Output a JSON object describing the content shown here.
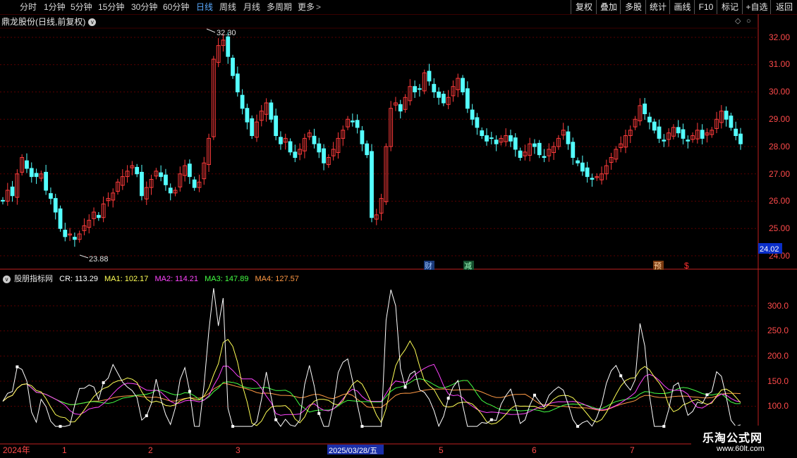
{
  "toolbar": {
    "periods": [
      "分时",
      "1分钟",
      "5分钟",
      "15分钟",
      "30分钟",
      "60分钟",
      "日线",
      "周线",
      "月线",
      "多周期",
      "更多"
    ],
    "active_period": "日线",
    "more_symbol": ">",
    "right_buttons": [
      "复权",
      "叠加",
      "多股",
      "统计",
      "画线",
      "F10",
      "标记",
      "+自选",
      "返回"
    ]
  },
  "stock": {
    "name": "鼎龙股份",
    "mode": "(日线,前复权)",
    "chevron": "v"
  },
  "price_axis": {
    "ticks": [
      "32.00",
      "31.00",
      "30.00",
      "29.00",
      "28.00",
      "27.00",
      "26.00",
      "25.00",
      "24.00"
    ],
    "current": "24.02"
  },
  "annotations": {
    "high": "32.30",
    "low": "23.88"
  },
  "event_markers": [
    {
      "label": "财",
      "color": "#3a7bd5"
    },
    {
      "label": "减",
      "color": "#2e8b57"
    },
    {
      "label": "预",
      "color": "#d2691e"
    },
    {
      "label": "$",
      "color": "#ff3030"
    }
  ],
  "indicator": {
    "name": "股朋指标网",
    "values": [
      {
        "label": "CR: 113.29",
        "color": "#ffffff"
      },
      {
        "label": "MA1: 102.17",
        "color": "#ffff55"
      },
      {
        "label": "MA2: 114.21",
        "color": "#ff44ff"
      },
      {
        "label": "MA3: 147.89",
        "color": "#44ff44"
      },
      {
        "label": "MA4: 127.57",
        "color": "#ff9944"
      }
    ],
    "ticks": [
      "300.0",
      "250.0",
      "200.0",
      "150.0",
      "100.0"
    ]
  },
  "date_axis": {
    "labels": [
      "2024年",
      "1",
      "2",
      "3",
      "2025/03/28/五",
      "5",
      "6",
      "7"
    ]
  },
  "colors": {
    "up": "#ff3b3b",
    "down": "#54ffff",
    "grid": "#5a0000",
    "axis": "#ff4a4a",
    "ma1": "#ffff55",
    "ma2": "#ff44ff",
    "ma3": "#44ff44",
    "ma4": "#ff9944",
    "cr": "#ffffff"
  },
  "watermark": {
    "line1": "乐淘公式网",
    "line2": "www.60lt.com"
  },
  "chart_data": [
    {
      "type": "candlestick",
      "title": "鼎龙股份 (日线,前复权)",
      "ylim": [
        23.6,
        32.6
      ],
      "y_ticks": [
        24,
        25,
        26,
        27,
        28,
        29,
        30,
        31,
        32
      ],
      "grid": true,
      "x_labels": [
        "2024年",
        "1",
        "2",
        "3",
        "2025/03/28/五",
        "5",
        "6",
        "7"
      ],
      "close": [
        26.0,
        26.4,
        26.2,
        27.0,
        27.6,
        27.2,
        26.9,
        26.9,
        27.0,
        26.4,
        26.1,
        25.6,
        25.0,
        24.7,
        24.8,
        24.6,
        24.8,
        25.1,
        25.3,
        25.6,
        25.4,
        25.9,
        26.1,
        26.3,
        26.7,
        26.9,
        27.1,
        27.3,
        27.0,
        26.2,
        26.5,
        26.8,
        27.1,
        26.9,
        26.6,
        26.3,
        26.4,
        27.0,
        27.3,
        26.9,
        26.5,
        26.7,
        27.4,
        28.3,
        31.2,
        31.7,
        31.9,
        31.3,
        30.6,
        30.0,
        29.4,
        28.9,
        28.4,
        28.9,
        29.3,
        29.6,
        29.0,
        28.4,
        28.1,
        28.3,
        27.8,
        27.6,
        27.9,
        28.3,
        28.5,
        28.1,
        27.8,
        27.4,
        27.6,
        27.9,
        28.3,
        28.6,
        29.0,
        28.9,
        28.7,
        28.1,
        27.7,
        25.4,
        25.5,
        26.1,
        28.0,
        29.4,
        29.6,
        29.3,
        29.8,
        30.2,
        30.0,
        30.1,
        30.7,
        30.4,
        30.0,
        29.8,
        29.6,
        29.8,
        30.2,
        30.5,
        30.0,
        29.4,
        29.0,
        28.7,
        28.4,
        28.2,
        28.3,
        28.1,
        28.3,
        28.4,
        28.2,
        27.9,
        27.6,
        27.8,
        28.1,
        28.0,
        27.7,
        27.6,
        27.9,
        28.0,
        28.3,
        28.6,
        28.1,
        27.6,
        27.4,
        27.1,
        26.9,
        26.8,
        26.9,
        27.0,
        27.3,
        27.6,
        27.9,
        28.1,
        28.4,
        28.6,
        29.0,
        29.5,
        29.2,
        28.9,
        28.6,
        28.3,
        28.2,
        28.5,
        28.7,
        28.5,
        28.3,
        28.2,
        28.4,
        28.6,
        28.3,
        28.5,
        28.6,
        29.0,
        29.3,
        29.0,
        28.7,
        28.4,
        28.1
      ],
      "annotations": {
        "high": 32.3,
        "low": 23.88
      }
    },
    {
      "type": "line",
      "title": "股朋指标网",
      "ylim": [
        50,
        340
      ],
      "y_ticks": [
        100,
        150,
        200,
        250,
        300
      ],
      "grid": true,
      "series": [
        {
          "name": "CR",
          "latest": 113.29
        },
        {
          "name": "MA1",
          "latest": 102.17
        },
        {
          "name": "MA2",
          "latest": 114.21
        },
        {
          "name": "MA3",
          "latest": 147.89
        },
        {
          "name": "MA4",
          "latest": 127.57
        }
      ]
    }
  ]
}
